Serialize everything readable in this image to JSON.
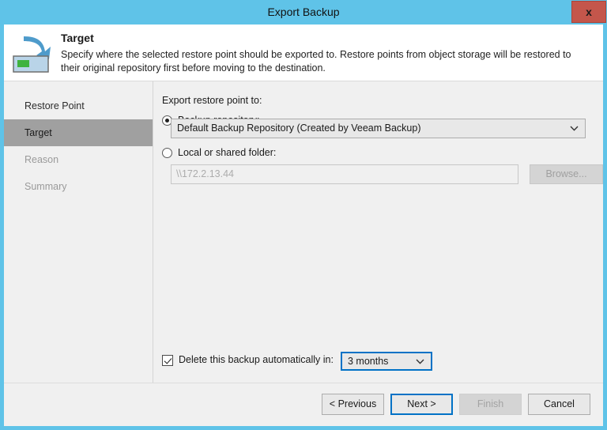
{
  "window": {
    "title": "Export Backup",
    "close_label": "x",
    "accent_color": "#5FC3E8",
    "close_color": "#C4564B"
  },
  "header": {
    "icon": "export-arrow-to-repository-icon",
    "title": "Target",
    "description": "Specify where the selected restore point should be exported to. Restore points from object storage will be restored to their original repository first before moving to the destination."
  },
  "sidebar": {
    "items": [
      {
        "label": "Restore Point",
        "state": "done"
      },
      {
        "label": "Target",
        "state": "selected"
      },
      {
        "label": "Reason",
        "state": "disabled"
      },
      {
        "label": "Summary",
        "state": "disabled"
      }
    ],
    "selected_color": "#A0A0A0"
  },
  "main": {
    "section_label": "Export restore point to:",
    "options": [
      {
        "id": "backup-repository",
        "label": "Backup repository:",
        "selected": true
      },
      {
        "id": "local-or-shared-folder",
        "label": "Local or shared folder:",
        "selected": false
      }
    ],
    "repository_combo": {
      "value": "Default Backup Repository (Created by Veeam Backup)",
      "arrow": "chevron-down-icon"
    },
    "folder_field": {
      "value": "\\\\172.2.13.44",
      "disabled": true
    },
    "browse_button": {
      "label": "Browse...",
      "disabled": true
    },
    "delete_option": {
      "checked": true,
      "label": "Delete this backup automatically in:",
      "period_value": "3 months",
      "arrow": "chevron-down-icon",
      "focus_color": "#0072C6"
    }
  },
  "footer": {
    "buttons": [
      {
        "id": "previous",
        "label": "< Previous",
        "state": "normal"
      },
      {
        "id": "next",
        "label": "Next >",
        "state": "default"
      },
      {
        "id": "finish",
        "label": "Finish",
        "state": "disabled"
      },
      {
        "id": "cancel",
        "label": "Cancel",
        "state": "normal"
      }
    ]
  }
}
